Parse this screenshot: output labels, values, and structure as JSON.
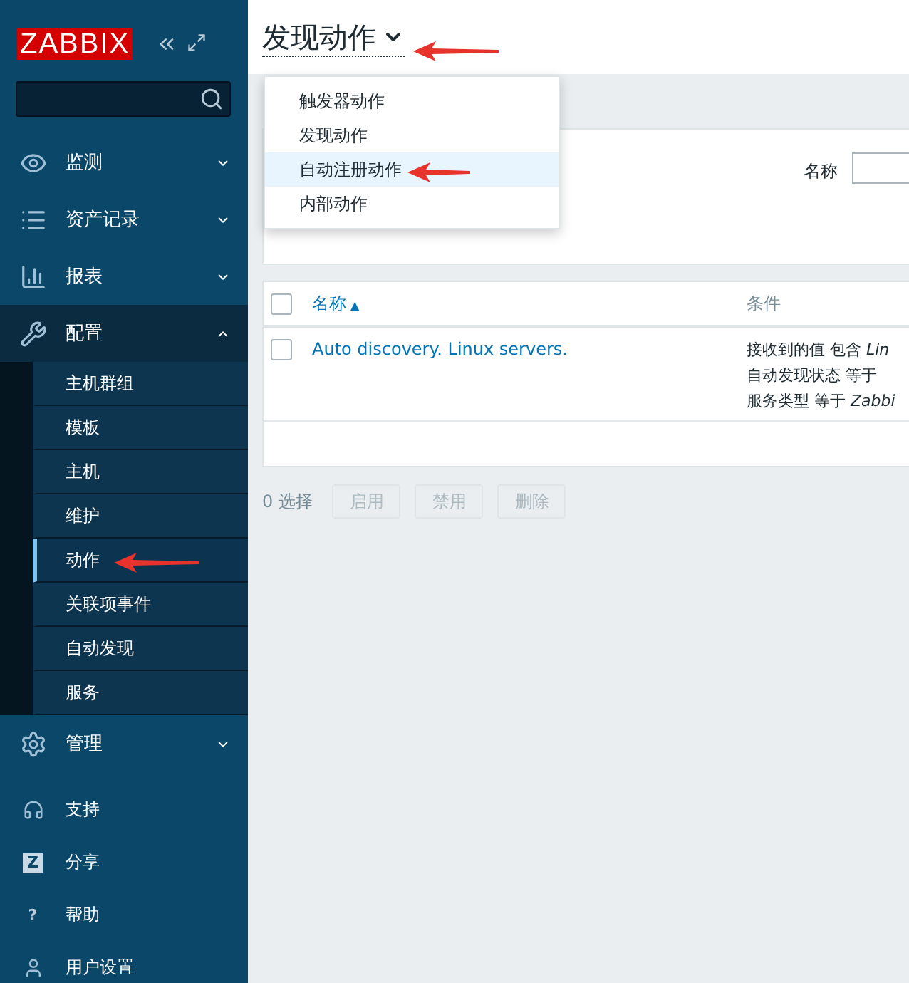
{
  "sidebar": {
    "logo": "ZABBIX",
    "menu": [
      {
        "label": "监测",
        "expanded": false
      },
      {
        "label": "资产记录",
        "expanded": false
      },
      {
        "label": "报表",
        "expanded": false
      },
      {
        "label": "配置",
        "expanded": true,
        "children": [
          {
            "label": "主机群组",
            "selected": false
          },
          {
            "label": "模板",
            "selected": false
          },
          {
            "label": "主机",
            "selected": false
          },
          {
            "label": "维护",
            "selected": false
          },
          {
            "label": "动作",
            "selected": true
          },
          {
            "label": "关联项事件",
            "selected": false
          },
          {
            "label": "自动发现",
            "selected": false
          },
          {
            "label": "服务",
            "selected": false
          }
        ]
      },
      {
        "label": "管理",
        "expanded": false
      }
    ],
    "footer": [
      {
        "label": "支持"
      },
      {
        "label": "分享",
        "glyph": "Z"
      },
      {
        "label": "帮助",
        "glyph": "?"
      },
      {
        "label": "用户设置"
      }
    ]
  },
  "page": {
    "title": "发现动作",
    "dropdown": [
      {
        "label": "触发器动作",
        "highlighted": false
      },
      {
        "label": "发现动作",
        "highlighted": false
      },
      {
        "label": "自动注册动作",
        "highlighted": true
      },
      {
        "label": "内部动作",
        "highlighted": false
      }
    ],
    "filter": {
      "name_label": "名称"
    },
    "table": {
      "columns": [
        "名称",
        "条件"
      ],
      "sort_mark": "▲",
      "select_all_checked": false,
      "rows": [
        {
          "name": "Auto discovery. Linux servers.",
          "checked": false,
          "conditions": [
            "接收到的值 包含 *Lin*",
            "自动发现状态 等于",
            "服务类型 等于 *Zabbi*"
          ]
        }
      ]
    },
    "selected_count": "0 选择",
    "actions": [
      {
        "label": "启用",
        "disabled": true
      },
      {
        "label": "禁用",
        "disabled": true
      },
      {
        "label": "删除",
        "disabled": true
      }
    ]
  }
}
